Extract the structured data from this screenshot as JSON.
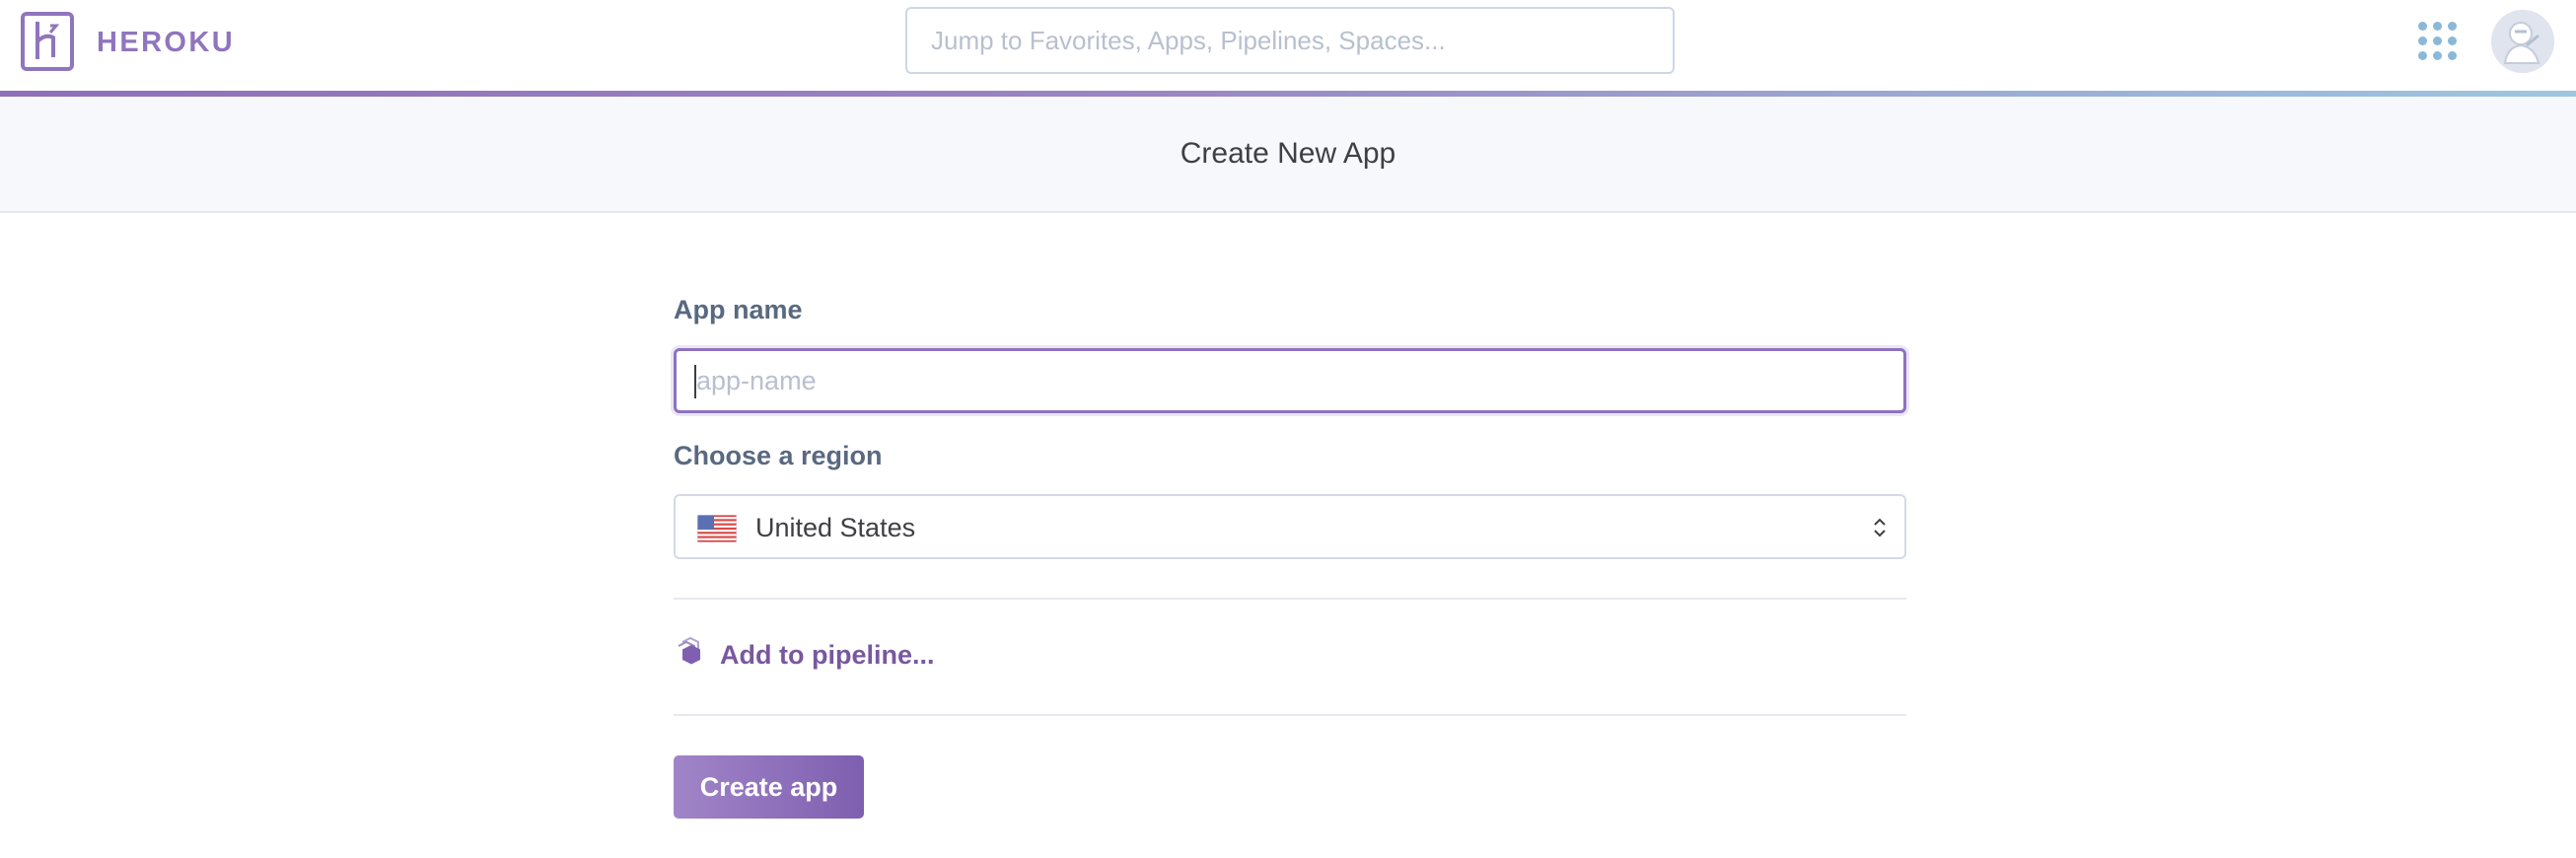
{
  "header": {
    "brand": "HEROKU",
    "search_placeholder": "Jump to Favorites, Apps, Pipelines, Spaces..."
  },
  "page": {
    "title": "Create New App"
  },
  "form": {
    "app_name_label": "App name",
    "app_name_value": "",
    "app_name_placeholder": "app-name",
    "region_label": "Choose a region",
    "region_selected": "United States",
    "pipeline_link": "Add to pipeline...",
    "submit_label": "Create app"
  },
  "colors": {
    "brand": "#8f75bd",
    "primary_button": "#7e5fb0",
    "link": "#79589f"
  },
  "icons": [
    "heroku-logo-icon",
    "apps-grid-icon",
    "avatar",
    "us-flag-icon",
    "select-arrows-icon",
    "pipeline-icon"
  ]
}
